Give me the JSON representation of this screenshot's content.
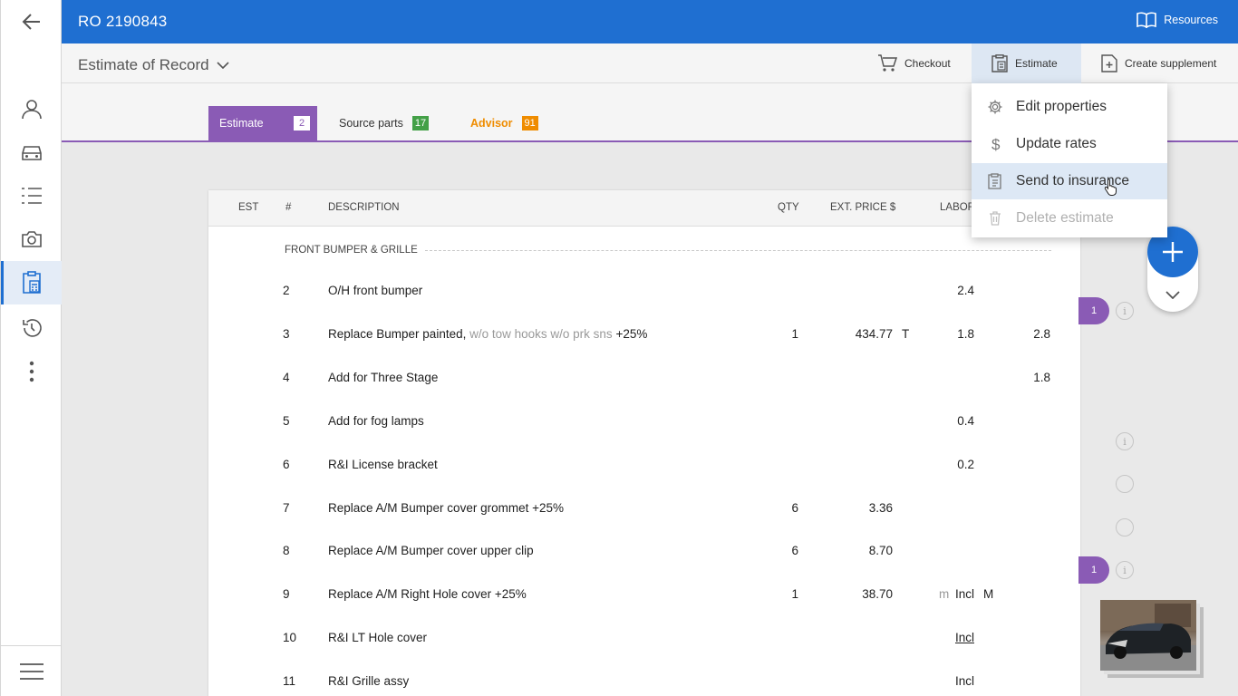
{
  "appbar": {
    "title": "RO 2190843",
    "resources_label": "Resources"
  },
  "toolbar": {
    "estimate_title": "Estimate of Record",
    "checkout_label": "Checkout",
    "estimate_label": "Estimate",
    "supplement_label": "Create supplement"
  },
  "tabs": [
    {
      "label": "Estimate",
      "count": "2",
      "color": "#8a5bb5"
    },
    {
      "label": "Source parts",
      "count": "17",
      "color": "#43a047"
    },
    {
      "label": "Advisor",
      "count": "91",
      "color": "#ef8c00"
    }
  ],
  "menu": {
    "items": [
      {
        "label": "Edit properties",
        "icon": "gear-icon"
      },
      {
        "label": "Update rates",
        "icon": "dollar-icon"
      },
      {
        "label": "Send to insurance",
        "icon": "clipboard-icon"
      },
      {
        "label": "Delete estimate",
        "icon": "trash-icon"
      }
    ]
  },
  "table": {
    "headers": {
      "est": "EST",
      "num": "#",
      "description": "DESCRIPTION",
      "qty": "QTY",
      "price": "EXT. PRICE $",
      "labor": "LABOR"
    },
    "section": "FRONT BUMPER & GRILLE",
    "rows": [
      {
        "num": "2",
        "desc": "O/H front bumper",
        "note": "",
        "suffix": "",
        "qty": "",
        "price": "",
        "type": "",
        "labor_prefix": "",
        "labor": "2.4",
        "labor_suffix": "",
        "paint": ""
      },
      {
        "num": "3",
        "desc": "Replace Bumper painted,",
        "note": "w/o tow hooks w/o prk sns",
        "suffix": "+25%",
        "qty": "1",
        "price": "434.77",
        "type": "T",
        "labor_prefix": "",
        "labor": "1.8",
        "labor_suffix": "",
        "paint": "2.8"
      },
      {
        "num": "4",
        "desc": "Add for Three Stage",
        "note": "",
        "suffix": "",
        "qty": "",
        "price": "",
        "type": "",
        "labor_prefix": "",
        "labor": "",
        "labor_suffix": "",
        "paint": "1.8"
      },
      {
        "num": "5",
        "desc": "Add for fog lamps",
        "note": "",
        "suffix": "",
        "qty": "",
        "price": "",
        "type": "",
        "labor_prefix": "",
        "labor": "0.4",
        "labor_suffix": "",
        "paint": ""
      },
      {
        "num": "6",
        "desc": "R&I License bracket",
        "note": "",
        "suffix": "",
        "qty": "",
        "price": "",
        "type": "",
        "labor_prefix": "",
        "labor": "0.2",
        "labor_suffix": "",
        "paint": ""
      },
      {
        "num": "7",
        "desc": "Replace A/M Bumper cover grommet +25%",
        "note": "",
        "suffix": "",
        "qty": "6",
        "price": "3.36",
        "type": "",
        "labor_prefix": "",
        "labor": "",
        "labor_suffix": "",
        "paint": ""
      },
      {
        "num": "8",
        "desc": "Replace A/M Bumper cover upper clip",
        "note": "",
        "suffix": "",
        "qty": "6",
        "price": "8.70",
        "type": "",
        "labor_prefix": "",
        "labor": "",
        "labor_suffix": "",
        "paint": ""
      },
      {
        "num": "9",
        "desc": "Replace A/M Right Hole cover +25%",
        "note": "",
        "suffix": "",
        "qty": "1",
        "price": "38.70",
        "type": "",
        "labor_prefix": "m",
        "labor": "Incl",
        "labor_suffix": "M",
        "paint": ""
      },
      {
        "num": "10",
        "desc": "R&I LT Hole cover",
        "note": "",
        "suffix": "",
        "qty": "",
        "price": "",
        "type": "",
        "labor_prefix": "",
        "labor": "Incl",
        "labor_suffix": "",
        "paint": ""
      },
      {
        "num": "11",
        "desc": "R&I Grille assy",
        "note": "",
        "suffix": "",
        "qty": "",
        "price": "",
        "type": "",
        "labor_prefix": "",
        "labor": "Incl",
        "labor_suffix": "",
        "paint": ""
      }
    ]
  },
  "side": {
    "pill_1": "1",
    "pill_2": "1"
  },
  "colors": {
    "primary": "#1f6fd1",
    "purple": "#8a5bb5",
    "green": "#43a047",
    "orange": "#ef8c00"
  }
}
